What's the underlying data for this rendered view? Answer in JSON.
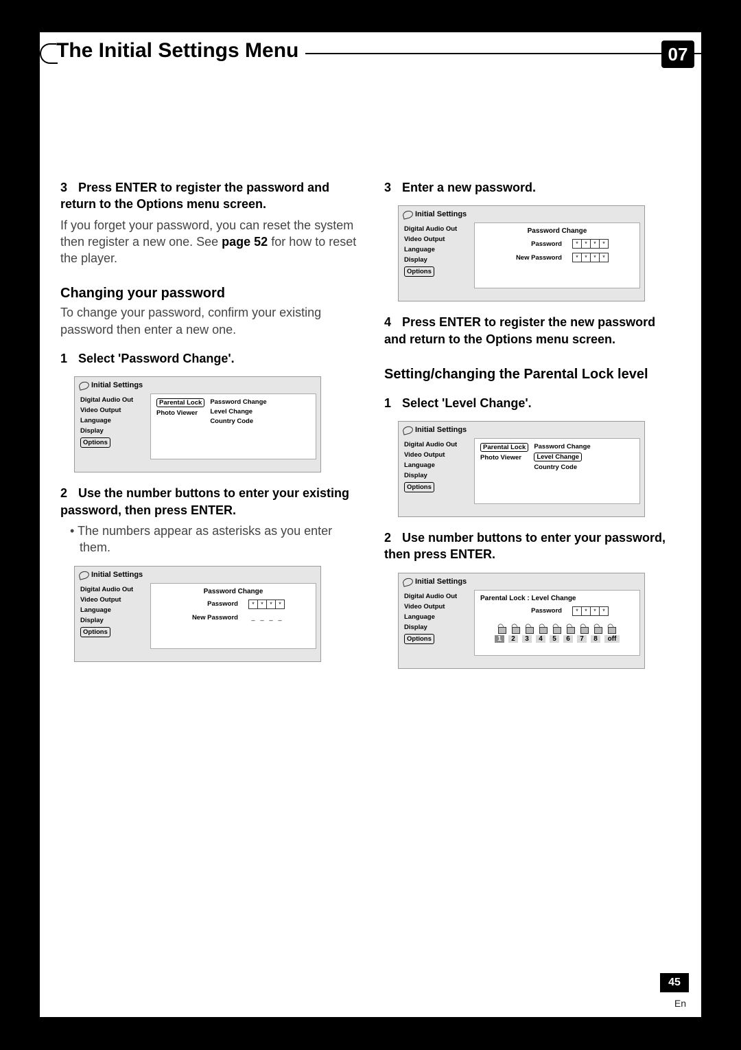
{
  "chapter": {
    "title": "The Initial Settings Menu",
    "number": "07"
  },
  "left": {
    "step3": "Press ENTER to register the password and return to the Options menu screen.",
    "forgot": "If you forget your password, you can reset the system then register a new one. See ",
    "forgot_bold": "page 52",
    "forgot_tail": " for how to reset the player.",
    "sec_change": "Changing your password",
    "change_desc": "To change your password, confirm your existing password then enter a new one.",
    "step1": "Select 'Password Change'.",
    "step2": "Use the number buttons to enter your existing password, then press ENTER.",
    "bullet": "The numbers appear as asterisks as you enter them."
  },
  "right": {
    "step3": "Enter a new password.",
    "step4": "Press ENTER to register the new password and return to the Options menu screen.",
    "sec_parental": "Setting/changing the Parental Lock level",
    "step1": "Select 'Level Change'.",
    "step2": "Use number buttons to enter your password, then press ENTER."
  },
  "ui": {
    "title": "Initial Settings",
    "sidebar": [
      "Digital Audio Out",
      "Video Output",
      "Language",
      "Display",
      "Options"
    ],
    "menu_col1": [
      "Parental Lock",
      "Photo Viewer"
    ],
    "menu_col2": [
      "Password Change",
      "Level Change",
      "Country Code"
    ],
    "pw_header": "Password Change",
    "pw_label": "Password",
    "newpw_label": "New Password",
    "level_header": "Parental Lock : Level Change",
    "levels": [
      "1",
      "2",
      "3",
      "4",
      "5",
      "6",
      "7",
      "8",
      "off"
    ]
  },
  "footer": {
    "page": "45",
    "lang": "En"
  }
}
